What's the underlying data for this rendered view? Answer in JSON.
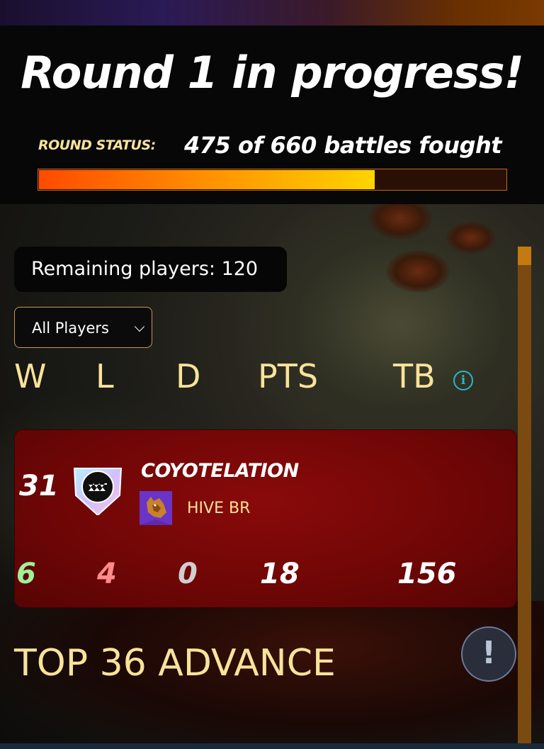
{
  "header": {
    "title": "Round 1 in progress!",
    "status_label": "ROUND STATUS:",
    "status_value": "475 of 660 battles fought",
    "battles_fought": 475,
    "battles_total": 660,
    "progress_fraction": 0.7197
  },
  "remaining": {
    "text": "Remaining players: 120"
  },
  "filter": {
    "selected": "All Players"
  },
  "columns": {
    "w": "W",
    "l": "L",
    "d": "D",
    "pts": "PTS",
    "tb": "TB",
    "info_icon": "info-icon"
  },
  "player": {
    "rank": "31",
    "name": "COYOTELATION",
    "guild": "HIVE BR",
    "wins": "6",
    "losses": "4",
    "draws": "0",
    "points": "18",
    "tiebreak": "156"
  },
  "footer": {
    "advance_text": "TOP 36 ADVANCE",
    "alert_symbol": "!"
  },
  "colors": {
    "accent_gold": "#f7e39a",
    "card_red": "#6e0606",
    "win_green": "#9ef09a",
    "loss_red": "#ff8a8a",
    "draw_gray": "#cfcfcf",
    "progress_orange": "#ff8a00",
    "info_teal": "#2ab7c5"
  }
}
